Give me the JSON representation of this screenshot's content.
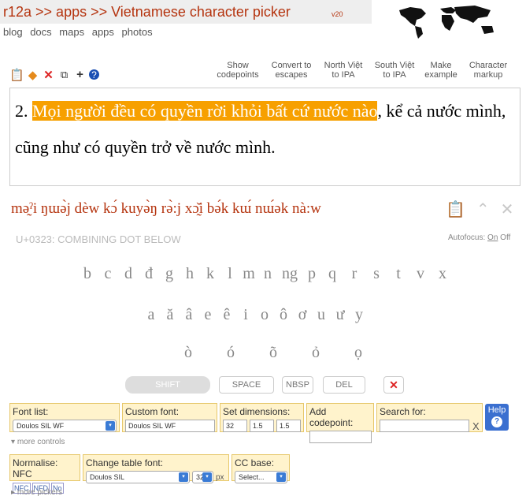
{
  "header": {
    "title": "r12a >> apps >> Vietnamese character picker",
    "version": "v20",
    "nav": [
      "blog",
      "docs",
      "maps",
      "apps",
      "photos"
    ]
  },
  "toolbar_links": [
    {
      "l1": "Show",
      "l2": "codepoints"
    },
    {
      "l1": "Convert to",
      "l2": "escapes"
    },
    {
      "l1": "North Việt",
      "l2": "to IPA"
    },
    {
      "l1": "South Việt",
      "l2": "to IPA"
    },
    {
      "l1": "Make",
      "l2": "example"
    },
    {
      "l1": "Character",
      "l2": "markup"
    }
  ],
  "editor": {
    "prefix": "2. ",
    "highlighted": "Mọi người đều có quyền rời khỏi bất cứ nước nào",
    "rest": ", kể cả nước mình, cũng như có quyền trở về nước mình."
  },
  "ipa_output": "mə̰ˀi ŋɯə̀j dèw kɔ́ kuyə̀ŋ rə̀:j xɔ̰̌i bə́k kɯ́ nɯ́ək nà:w",
  "codepoint_info": "U+0323: COMBINING DOT BELOW",
  "autofocus": {
    "label": "Autofocus:",
    "on": "On",
    "off": "Off"
  },
  "consonants": [
    "b",
    "c",
    "d",
    "đ",
    "g",
    "h",
    "k",
    "l",
    "m",
    "n",
    "ng",
    "p",
    "q",
    "r",
    "s",
    "t",
    "v",
    "x"
  ],
  "vowels": [
    "a",
    "ă",
    "â",
    "e",
    "ê",
    "i",
    "o",
    "ô",
    "ơ",
    "u",
    "ư",
    "y"
  ],
  "tones": [
    "ò",
    "ó",
    "õ",
    "ỏ",
    "ọ"
  ],
  "buttons": {
    "shift": "SHIFT",
    "space": "SPACE",
    "nbsp": "NBSP",
    "del": "DEL",
    "clear": "✕"
  },
  "controls": {
    "font_list_label": "Font list:",
    "font_list_value": "Doulos SIL WF",
    "custom_font_label": "Custom font:",
    "custom_font_value": "Doulos SIL WF",
    "dimensions_label": "Set dimensions:",
    "dim1": "32",
    "dim2": "1.5",
    "dim3": "1.5",
    "add_codepoint_label": "Add codepoint:",
    "search_label": "Search for:",
    "search_clear": "X",
    "help": "Help",
    "help_icon": "?",
    "more_controls": "more controls",
    "normalise_label": "Normalise: NFC",
    "nfc": "NFC",
    "nfd": "NFD",
    "no": "No",
    "table_font_label": "Change table font:",
    "table_font_value": "Doulos SIL",
    "table_font_size": "32",
    "px": "px",
    "cc_base_label": "CC base:",
    "cc_base_value": "Select...",
    "more_pickers": "more pickers"
  }
}
